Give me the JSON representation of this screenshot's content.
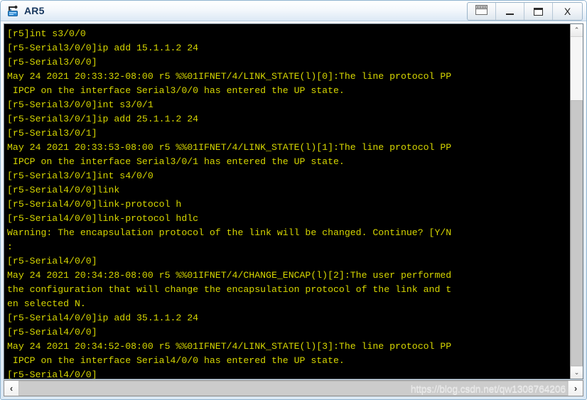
{
  "window": {
    "title": "AR5",
    "icon": "router-icon",
    "controls": [
      {
        "name": "restore-panel-button",
        "label": "",
        "icon": "window-panel-icon"
      },
      {
        "name": "minimize-button",
        "label": "",
        "icon": "minimize-icon"
      },
      {
        "name": "maximize-button",
        "label": "",
        "icon": "maximize-icon"
      },
      {
        "name": "close-button",
        "label": "X",
        "icon": "close-icon"
      }
    ]
  },
  "console": {
    "foreground_color": "#d6d600",
    "background_color": "#000000",
    "lines": [
      "[r5]int s3/0/0",
      "[r5-Serial3/0/0]ip add 15.1.1.2 24",
      "[r5-Serial3/0/0]",
      "May 24 2021 20:33:32-08:00 r5 %%01IFNET/4/LINK_STATE(l)[0]:The line protocol PP",
      " IPCP on the interface Serial3/0/0 has entered the UP state.",
      "[r5-Serial3/0/0]int s3/0/1",
      "[r5-Serial3/0/1]ip add 25.1.1.2 24",
      "[r5-Serial3/0/1]",
      "May 24 2021 20:33:53-08:00 r5 %%01IFNET/4/LINK_STATE(l)[1]:The line protocol PP",
      " IPCP on the interface Serial3/0/1 has entered the UP state.",
      "[r5-Serial3/0/1]int s4/0/0",
      "[r5-Serial4/0/0]link",
      "[r5-Serial4/0/0]link-protocol h",
      "[r5-Serial4/0/0]link-protocol hdlc",
      "Warning: The encapsulation protocol of the link will be changed. Continue? [Y/N",
      ":",
      "[r5-Serial4/0/0]",
      "May 24 2021 20:34:28-08:00 r5 %%01IFNET/4/CHANGE_ENCAP(l)[2]:The user performed",
      "the configuration that will change the encapsulation protocol of the link and t",
      "en selected N.",
      "[r5-Serial4/0/0]ip add 35.1.1.2 24",
      "[r5-Serial4/0/0]",
      "May 24 2021 20:34:52-08:00 r5 %%01IFNET/4/LINK_STATE(l)[3]:The line protocol PP",
      " IPCP on the interface Serial4/0/0 has entered the UP state.",
      "[r5-Serial4/0/0]"
    ]
  },
  "scrollbars": {
    "vertical": {
      "up_arrow": "⌃",
      "down_arrow": "⌄"
    },
    "horizontal": {
      "left_arrow": "‹",
      "right_arrow": "›"
    }
  },
  "watermark": {
    "text": "https://blog.csdn.net/qw1308764206"
  }
}
